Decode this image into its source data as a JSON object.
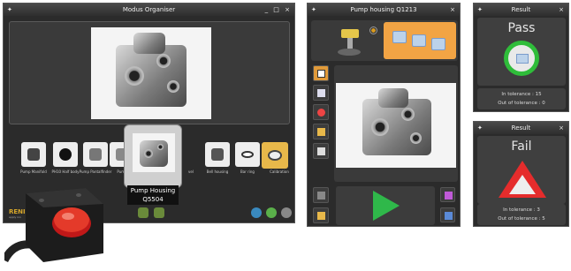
{
  "main_window": {
    "title": "Modus Organiser",
    "controls": [
      "_",
      "□",
      "×"
    ],
    "brand": "RENI",
    "brand_sub": "apply inn",
    "parts": [
      {
        "label": "Pump Manifold"
      },
      {
        "label": "PH10 Half body"
      },
      {
        "label": "Pump Pantalfinder"
      },
      {
        "label": "Pump"
      },
      {
        "label": "vel"
      },
      {
        "label": "Bell housing"
      },
      {
        "label": "Bar ring"
      },
      {
        "label": "Calibration"
      }
    ],
    "selected_part": {
      "name": "Pump Housing",
      "code": "Q5504"
    }
  },
  "pump_window": {
    "title": "Pump housing Q1213",
    "close": "×",
    "accent": "#f2a444",
    "run_color": "#2fb84a"
  },
  "pass_window": {
    "title": "Result",
    "close": "×",
    "result": "Pass",
    "in_tolerance": "In tolerance : 15",
    "out_of_tolerance": "Out of tolerance : 0",
    "color": "#2fbd3a"
  },
  "fail_window": {
    "title": "Result",
    "close": "×",
    "result": "Fail",
    "in_tolerance": "In tolerance : 3",
    "out_of_tolerance": "Out of tolerance : 5",
    "color": "#e52c2c"
  },
  "icons": [
    "pin-icon",
    "probe-icon",
    "fixture-icon",
    "play-icon",
    "pass-ring-icon",
    "fail-triangle-icon",
    "calibration-icon",
    "emergency-stop-icon"
  ]
}
